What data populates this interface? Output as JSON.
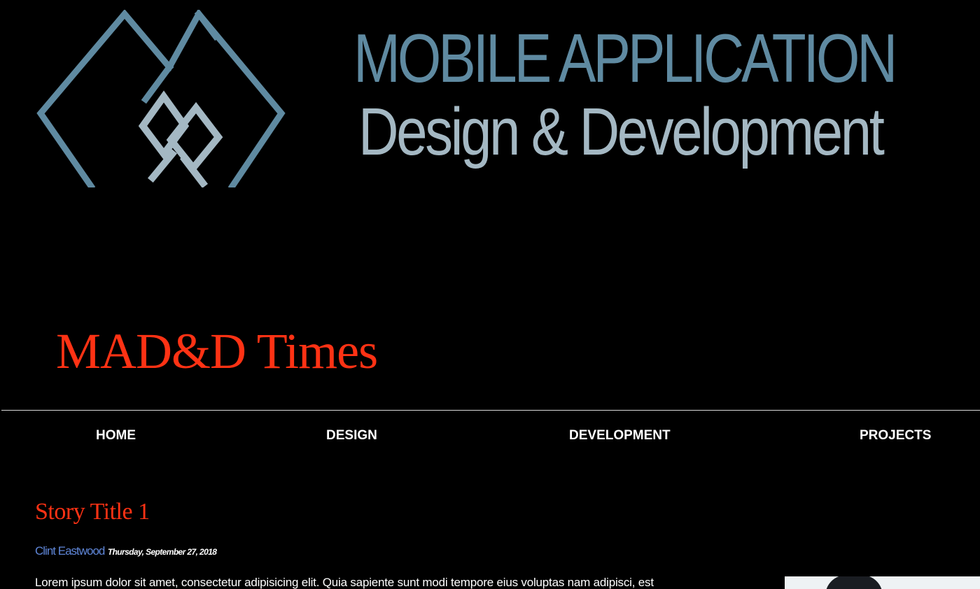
{
  "brand": {
    "line1": "MOBILE APPLICATION",
    "line2": "Design & Development",
    "logo_icon": "linked-diamonds-logo-icon",
    "colors": {
      "primary": "#5f8aa1",
      "secondary": "#a4b8c3"
    }
  },
  "site": {
    "title": "MAD&D Times",
    "title_color": "#ff3214"
  },
  "nav": {
    "items": [
      {
        "label": "HOME"
      },
      {
        "label": "DESIGN"
      },
      {
        "label": "DEVELOPMENT"
      },
      {
        "label": "PROJECTS"
      }
    ]
  },
  "story": {
    "title": "Story Title 1",
    "author": "Clint Eastwood",
    "date": "Thursday, September 27, 2018",
    "body": "Lorem ipsum dolor sit amet, consectetur adipisicing elit. Quia sapiente sunt modi tempore eius voluptas nam adipisci, est",
    "author_color": "#5f86d8"
  }
}
